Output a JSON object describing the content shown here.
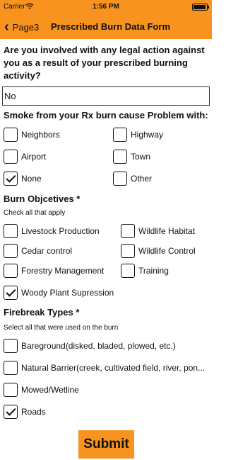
{
  "status_bar": {
    "carrier": "Carrier",
    "time": "1:56 PM",
    "battery_level": 0.95
  },
  "nav": {
    "back_label": "Page3",
    "title": "Prescribed Burn Data Form"
  },
  "legal": {
    "question": "Are you involved with any legal action against you as a result of your prescribed burning activity?",
    "value": "No"
  },
  "smoke": {
    "question": "Smoke from your Rx burn cause Problem with:",
    "options": [
      {
        "label": "Neighbors",
        "checked": false
      },
      {
        "label": "Highway",
        "checked": false
      },
      {
        "label": "Airport",
        "checked": false
      },
      {
        "label": "Town",
        "checked": false
      },
      {
        "label": "None",
        "checked": true
      },
      {
        "label": "Other",
        "checked": false
      }
    ]
  },
  "objectives": {
    "heading": "Burn Objcetives *",
    "hint": "Check all that apply",
    "options": [
      {
        "label": "Livestock Production",
        "checked": false
      },
      {
        "label": "Wildlife Habitat",
        "checked": false
      },
      {
        "label": "Cedar control",
        "checked": false
      },
      {
        "label": "Wildlife Control",
        "checked": false
      },
      {
        "label": "Forestry Management",
        "checked": false
      },
      {
        "label": "Training",
        "checked": false
      },
      {
        "label": "Woody Plant Supression",
        "checked": true
      }
    ]
  },
  "firebreak": {
    "heading": "Firebreak Types *",
    "hint": "Select all that were used on the burn",
    "options": [
      {
        "label": "Bareground(disked, bladed, plowed, etc.)",
        "checked": false
      },
      {
        "label": "Natural Barrier(creek, cultivated field, river, pon...",
        "checked": false
      },
      {
        "label": "Mowed/Wetline",
        "checked": false
      },
      {
        "label": "Roads",
        "checked": true
      }
    ]
  },
  "submit_label": "Submit",
  "colors": {
    "accent": "#f7931e",
    "text": "#111111",
    "background": "#ffffff"
  }
}
